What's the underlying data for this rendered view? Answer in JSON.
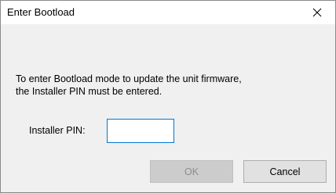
{
  "window": {
    "title": "Enter Bootload",
    "close_icon": "close-icon"
  },
  "message": {
    "line1": "To enter Bootload mode to update the unit firmware,",
    "line2": "the Installer PIN must be entered."
  },
  "pin": {
    "label": "Installer PIN:",
    "value": ""
  },
  "buttons": {
    "ok_label": "OK",
    "ok_enabled": false,
    "cancel_label": "Cancel"
  },
  "colors": {
    "focus_border": "#0078d7",
    "dialog_background": "#f0f0f0",
    "disabled_text": "#8c8c8c"
  }
}
